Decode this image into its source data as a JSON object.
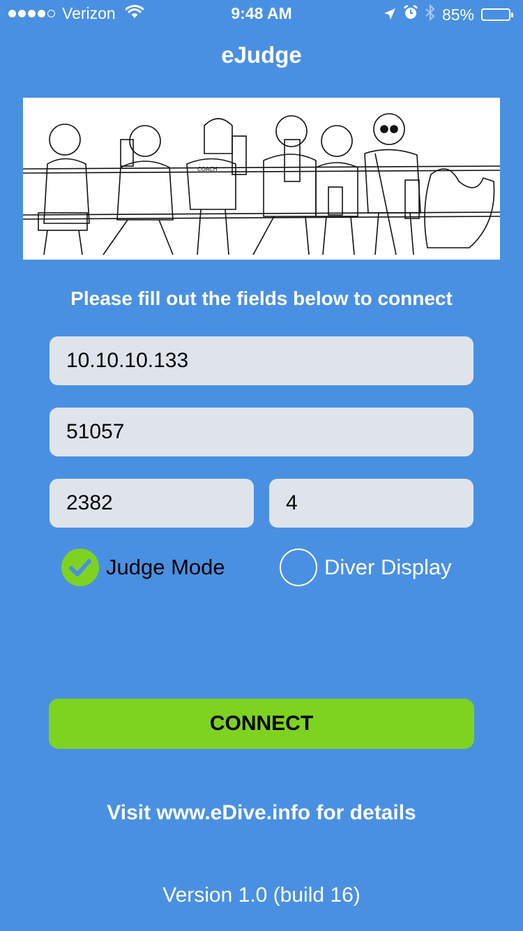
{
  "status_bar": {
    "signal_bars_filled": 4,
    "signal_bars_total": 5,
    "carrier": "Verizon",
    "time": "9:48 AM",
    "battery_percent_label": "85%",
    "battery_level": 0.85,
    "icons": [
      "wifi-icon",
      "location-arrow-icon",
      "alarm-clock-icon",
      "bluetooth-icon",
      "battery-icon"
    ]
  },
  "nav": {
    "title": "eJudge"
  },
  "banner": {
    "description": "Cartoon illustration of a row of diving judges holding score cards"
  },
  "form": {
    "instructions": "Please fill out the fields below to connect",
    "fields": {
      "host": {
        "value": "10.10.10.133"
      },
      "port": {
        "value": "51057"
      },
      "field_a": {
        "value": "2382"
      },
      "field_b": {
        "value": "4"
      }
    },
    "modes": [
      {
        "label": "Judge Mode",
        "selected": true
      },
      {
        "label": "Diver Display",
        "selected": false
      }
    ],
    "connect_label": "CONNECT"
  },
  "footer": {
    "visit": "Visit www.eDive.info for details",
    "version": "Version 1.0 (build 16)"
  },
  "colors": {
    "background": "#4a90e2",
    "field": "#dfe4ec",
    "accent_green": "#7ed321",
    "check_blue": "#4a90e2"
  }
}
